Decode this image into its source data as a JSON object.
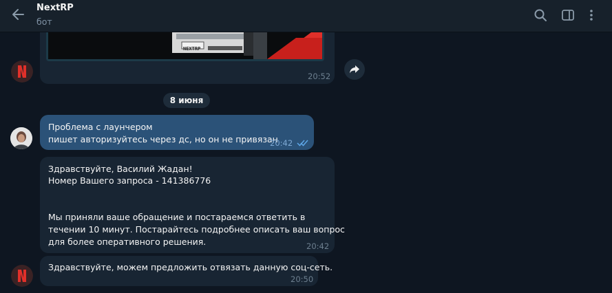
{
  "header": {
    "title": "NextRP",
    "subtitle": "бот",
    "icons": [
      "back-arrow-icon",
      "search-icon",
      "sidebar-toggle-icon",
      "more-vertical-icon"
    ]
  },
  "chat": {
    "date_separator": "8 июня",
    "media_message": {
      "time": "20:52",
      "image_plate_text": "NEXTRP"
    },
    "messages": [
      {
        "direction": "out",
        "lines": [
          "Проблема с лаунчером",
          "пишет авторизуйтесь через дс, но он не привязан"
        ],
        "time": "20:42",
        "status": "read"
      },
      {
        "direction": "in",
        "lines": [
          "Здравствуйте, Василий Жадан!",
          "Номер Вашего запроса - 141386776",
          "",
          "",
          "Мы приняли ваше обращение и постараемся ответить в",
          "течении 10 минут. Постарайтесь подробнее описать ваш вопрос",
          "для более оперативного решения."
        ],
        "time": "20:42"
      },
      {
        "direction": "in",
        "lines": [
          "Здравствуйте, можем предложить отвязать данную соц-сеть."
        ],
        "time": "20:50"
      }
    ]
  },
  "colors": {
    "background": "#0e1621",
    "header": "#17212b",
    "incoming_bubble": "#182533",
    "outgoing_bubble": "#2b5278",
    "accent_red": "#e0302a",
    "read_check": "#5ea7e8"
  }
}
